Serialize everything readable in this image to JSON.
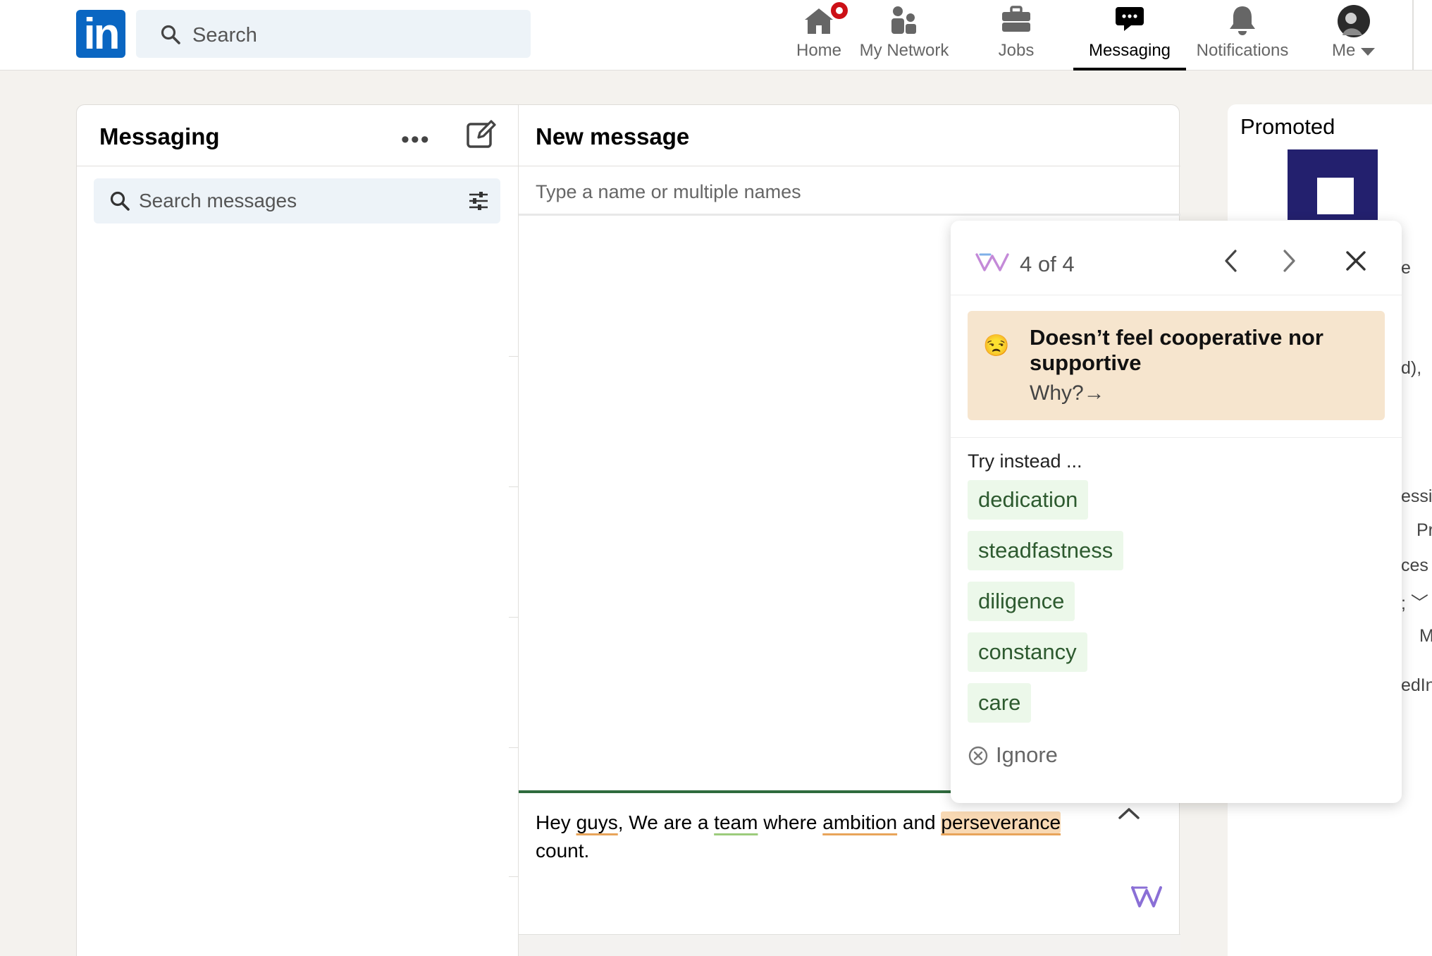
{
  "nav": {
    "logo": "in",
    "search_placeholder": "Search",
    "items": [
      {
        "label": "Home",
        "icon": "home-icon"
      },
      {
        "label": "My Network",
        "icon": "network-icon"
      },
      {
        "label": "Jobs",
        "icon": "briefcase-icon"
      },
      {
        "label": "Messaging",
        "icon": "messaging-icon",
        "active": true
      },
      {
        "label": "Notifications",
        "icon": "bell-icon"
      },
      {
        "label": "Me",
        "icon": "avatar"
      }
    ],
    "colors": {
      "brand": "#0a66c2",
      "badge": "#cc1016"
    }
  },
  "messaging": {
    "title": "Messaging",
    "more_icon": "ellipsis-icon",
    "compose_icon": "compose-icon",
    "search_placeholder": "Search messages",
    "filter_icon": "filter-icon"
  },
  "new_message": {
    "title": "New message",
    "recipient_placeholder": "Type a name or multiple names",
    "body": {
      "w1": "Hey ",
      "w2": "guys",
      "w3": ", We are a ",
      "w4": "team",
      "w5": " where ",
      "w6": "ambition",
      "w7": " and ",
      "w8": "perseverance",
      "w9": " count."
    }
  },
  "promoted": {
    "title": "Promoted",
    "fragments": [
      "e",
      "d),",
      "essib",
      "Pr",
      "ces",
      "; ﹀",
      "M",
      "edIn"
    ]
  },
  "popup": {
    "count": "4 of 4",
    "issue": {
      "emoji": "😒",
      "headline": "Doesn’t feel cooperative nor supportive",
      "why": "Why?→"
    },
    "try_instead": "Try instead ...",
    "suggestions": [
      "dedication",
      "steadfastness",
      "diligence",
      "constancy",
      "care"
    ],
    "ignore": "Ignore",
    "colors": {
      "issue_bg": "#f6e5ce",
      "suggestion_bg": "#ecf8ea",
      "suggestion_text": "#2d5a2f"
    }
  }
}
